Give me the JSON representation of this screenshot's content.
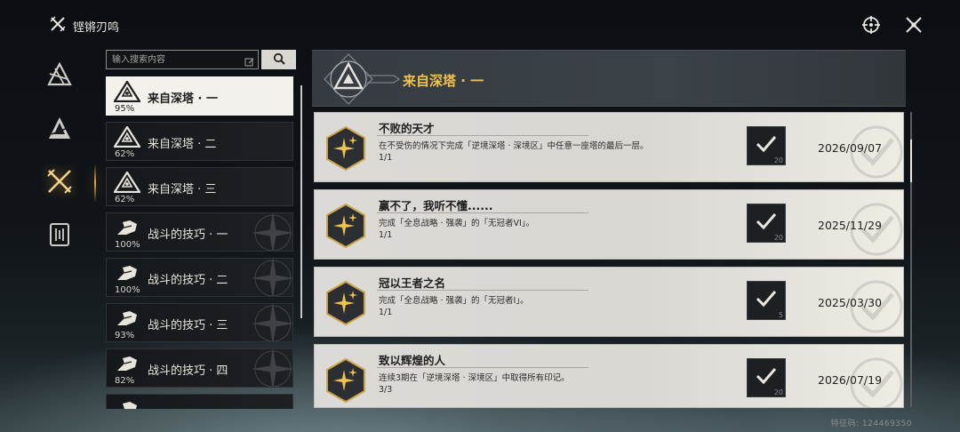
{
  "app": {
    "title": "铿锵刃鸣"
  },
  "top_icons": [
    "target-icon",
    "close-icon"
  ],
  "nav": [
    {
      "name": "nav-emblem-1",
      "icon": "triangle-sigil-icon",
      "active": false
    },
    {
      "name": "nav-emblem-2",
      "icon": "pyramid-icon",
      "active": false
    },
    {
      "name": "nav-emblem-3",
      "icon": "crossed-blades-icon",
      "active": true
    },
    {
      "name": "nav-emblem-4",
      "icon": "cards-icon",
      "active": false
    }
  ],
  "search": {
    "placeholder": "输入搜索内容"
  },
  "categories": [
    {
      "name": "来自深塔 · 一",
      "percent": "95%",
      "icon": "tower-icon",
      "active": true
    },
    {
      "name": "来自深塔 · 二",
      "percent": "62%",
      "icon": "tower-icon",
      "active": false
    },
    {
      "name": "来自深塔 · 三",
      "percent": "62%",
      "icon": "tower-icon",
      "active": false
    },
    {
      "name": "战斗的技巧 · 一",
      "percent": "100%",
      "icon": "fist-icon",
      "active": false
    },
    {
      "name": "战斗的技巧 · 二",
      "percent": "100%",
      "icon": "fist-icon",
      "active": false
    },
    {
      "name": "战斗的技巧 · 三",
      "percent": "93%",
      "icon": "fist-icon",
      "active": false
    },
    {
      "name": "战斗的技巧 · 四",
      "percent": "82%",
      "icon": "fist-icon",
      "active": false
    },
    {
      "name": "",
      "percent": "",
      "icon": "fist-icon",
      "active": false
    }
  ],
  "header": {
    "title": "来自深塔 · 一"
  },
  "achievements": [
    {
      "title": "不败的天才",
      "desc": "在不受伤的情况下完成「逆境深塔 · 深境区」中任意一座塔的最后一层。",
      "progress": "1/1",
      "reward_qty": "20",
      "date": "2026/09/07"
    },
    {
      "title": "赢不了，我听不懂......",
      "desc": "完成「全息战略 · 强袭」的「无冠者VI」。",
      "progress": "1/1",
      "reward_qty": "20",
      "date": "2025/11/29"
    },
    {
      "title": "冠以王者之名",
      "desc": "完成「全息战略 · 强袭」的「无冠者I」。",
      "progress": "1/1",
      "reward_qty": "5",
      "date": "2025/03/30"
    },
    {
      "title": "致以辉煌的人",
      "desc": "连续3期在「逆境深塔 · 深境区」中取得所有印记。",
      "progress": "3/3",
      "reward_qty": "20",
      "date": "2026/07/19"
    }
  ],
  "footer": {
    "uid": "特征码: 124469350"
  },
  "colors": {
    "accent_gold": "#f1c24e",
    "active_nav_glow": "#e9a84a",
    "panel_light": "#dcdad6"
  }
}
